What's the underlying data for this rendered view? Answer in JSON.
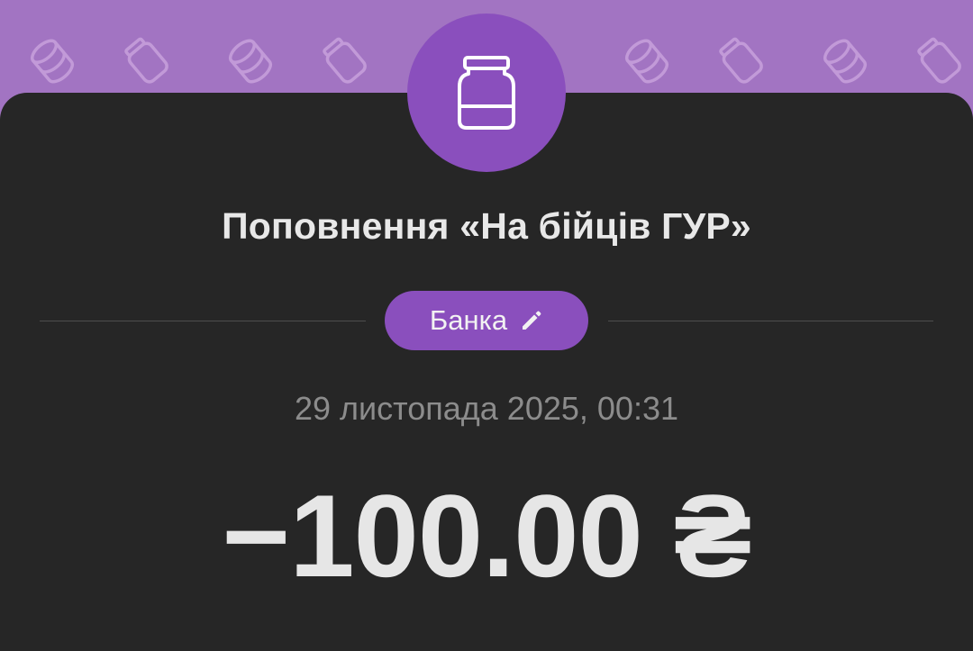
{
  "header": {
    "background_color": "#a274c2",
    "pattern_icons": [
      "coins-icon",
      "jar-icon"
    ],
    "badge_icon": "jar-icon",
    "badge_color": "#8a4fbd"
  },
  "transaction": {
    "title": "Поповнення «На бійців ГУР»",
    "category_label": "Банка",
    "category_edit_icon": "pencil-icon",
    "datetime": "29 листопада 2025, 00:31",
    "amount": "−100.00 ₴"
  }
}
